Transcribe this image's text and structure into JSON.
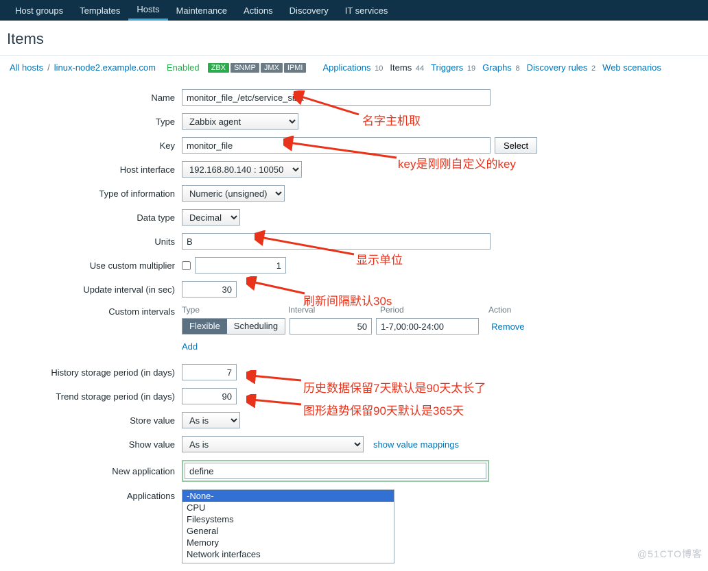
{
  "topnav": [
    "Host groups",
    "Templates",
    "Hosts",
    "Maintenance",
    "Actions",
    "Discovery",
    "IT services"
  ],
  "topnav_active": 2,
  "page_title": "Items",
  "breadcrumb": {
    "all_hosts": "All hosts",
    "host": "linux-node2.example.com",
    "enabled": "Enabled"
  },
  "badges": [
    {
      "text": "ZBX",
      "green": true
    },
    {
      "text": "SNMP",
      "green": false
    },
    {
      "text": "JMX",
      "green": false
    },
    {
      "text": "IPMI",
      "green": false
    }
  ],
  "tabs": [
    {
      "label": "Applications",
      "count": "10"
    },
    {
      "label": "Items",
      "count": "44",
      "active": true
    },
    {
      "label": "Triggers",
      "count": "19"
    },
    {
      "label": "Graphs",
      "count": "8"
    },
    {
      "label": "Discovery rules",
      "count": "2"
    },
    {
      "label": "Web scenarios",
      "count": ""
    }
  ],
  "labels": {
    "name": "Name",
    "type": "Type",
    "key": "Key",
    "select": "Select",
    "host_interface": "Host interface",
    "type_info": "Type of information",
    "data_type": "Data type",
    "units": "Units",
    "use_mult": "Use custom multiplier",
    "update_interval": "Update interval (in sec)",
    "custom_intervals": "Custom intervals",
    "ci_type": "Type",
    "ci_interval": "Interval",
    "ci_period": "Period",
    "ci_action": "Action",
    "flexible": "Flexible",
    "scheduling": "Scheduling",
    "remove": "Remove",
    "add": "Add",
    "history": "History storage period (in days)",
    "trend": "Trend storage period (in days)",
    "store_value": "Store value",
    "show_value": "Show value",
    "show_value_link": "show value mappings",
    "new_app": "New application",
    "applications": "Applications"
  },
  "values": {
    "name": "monitor_file_/etc/service_siza",
    "type": "Zabbix agent",
    "key": "monitor_file",
    "host_interface": "192.168.80.140 : 10050",
    "type_info": "Numeric (unsigned)",
    "data_type": "Decimal",
    "units": "B",
    "multiplier": "1",
    "update_interval": "30",
    "ci_interval": "50",
    "ci_period": "1-7,00:00-24:00",
    "history": "7",
    "trend": "90",
    "store_value": "As is",
    "show_value": "As is",
    "new_app": "define"
  },
  "applications": [
    "-None-",
    "CPU",
    "Filesystems",
    "General",
    "Memory",
    "Network interfaces"
  ],
  "applications_selected": 0,
  "annotations": {
    "a1": "名字主机取",
    "a2": "key是刚刚自定义的key",
    "a3": "显示单位",
    "a4": "刷新间隔默认30s",
    "a5": "历史数据保留7天默认是90天太长了",
    "a6": "图形趋势保留90天默认是365天"
  },
  "watermark": "@51CTO博客"
}
